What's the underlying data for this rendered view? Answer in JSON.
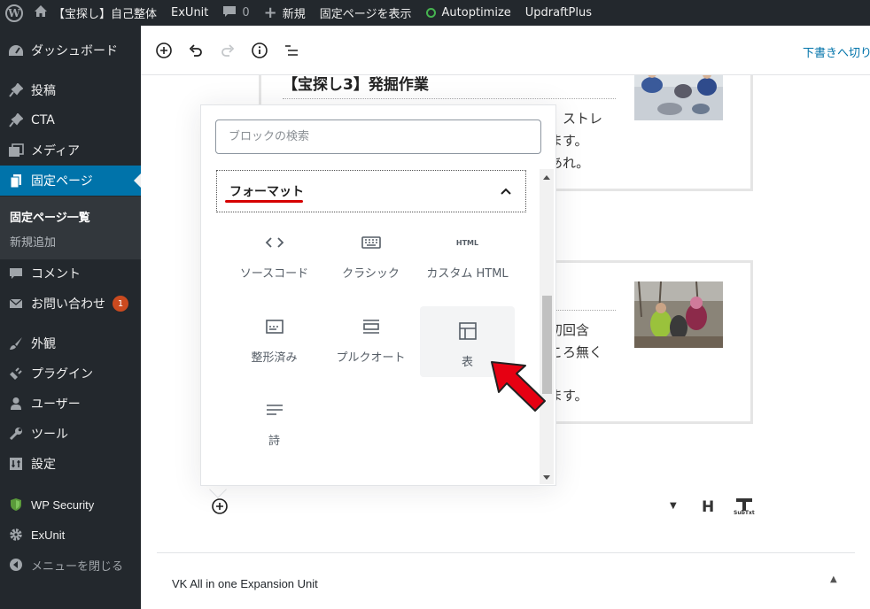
{
  "admin_bar": {
    "logo_icon": "wordpress-logo-icon",
    "site_icon": "home-icon",
    "site_name": "【宝探し】自己整体",
    "exunit": "ExUnit",
    "comments_count": "0",
    "new_label": "新規",
    "view_page": "固定ページを表示",
    "autoptimize": "Autoptimize",
    "updraftplus": "UpdraftPlus"
  },
  "sidebar": {
    "items": [
      {
        "label": "ダッシュボード",
        "icon": "dashboard-icon"
      },
      {
        "label": "投稿",
        "icon": "pin-icon"
      },
      {
        "label": "CTA",
        "icon": "pin-icon"
      },
      {
        "label": "メディア",
        "icon": "media-icon"
      },
      {
        "label": "固定ページ",
        "icon": "page-icon"
      },
      {
        "label": "コメント",
        "icon": "comment-icon"
      },
      {
        "label": "お問い合わせ",
        "icon": "mail-icon",
        "badge": "1"
      },
      {
        "label": "外観",
        "icon": "brush-icon"
      },
      {
        "label": "プラグイン",
        "icon": "plugin-icon"
      },
      {
        "label": "ユーザー",
        "icon": "user-icon"
      },
      {
        "label": "ツール",
        "icon": "wrench-icon"
      },
      {
        "label": "設定",
        "icon": "settings-icon"
      },
      {
        "label": "WP Security",
        "icon": "shield-icon"
      },
      {
        "label": "ExUnit",
        "icon": "gear-icon"
      },
      {
        "label": "メニューを閉じる",
        "icon": "collapse-icon"
      }
    ],
    "submenu": [
      "固定ページ一覧",
      "新規追加"
    ]
  },
  "toolbar": {
    "draft_link": "下書きへ切り"
  },
  "content": {
    "card1": {
      "title": "【宝探し3】発掘作業",
      "lines": [
        "。ストレ",
        "ます。",
        "あれ。"
      ]
    },
    "card2": {
      "lines": [
        "初回含",
        "ころ無く",
        "ます。"
      ]
    }
  },
  "block_toolbar": {
    "heading_label": "H",
    "subtext_label": "SubTxt"
  },
  "inserter": {
    "search_placeholder": "ブロックの検索",
    "panel_title": "フォーマット",
    "blocks": [
      {
        "label": "ソースコード",
        "icon": "code-icon"
      },
      {
        "label": "クラシック",
        "icon": "keyboard-icon"
      },
      {
        "label": "カスタム HTML",
        "icon": "html-icon",
        "icon_text": "HTML"
      },
      {
        "label": "整形済み",
        "icon": "preformatted-icon"
      },
      {
        "label": "プルクオート",
        "icon": "pullquote-icon"
      },
      {
        "label": "表",
        "icon": "table-icon"
      },
      {
        "label": "詩",
        "icon": "verse-icon"
      }
    ]
  },
  "metabox": {
    "title": "VK All in one Expansion Unit"
  },
  "colors": {
    "admin_dark": "#23282d",
    "wp_blue": "#0073aa",
    "accent_red": "#e60012"
  }
}
